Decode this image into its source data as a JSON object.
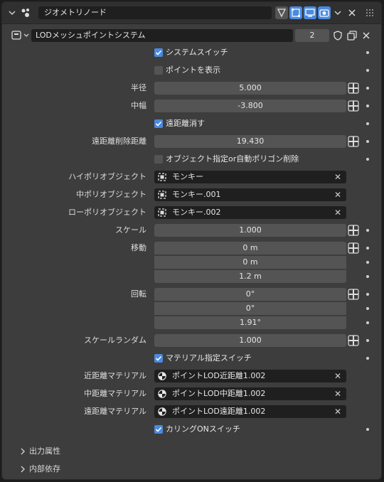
{
  "header": {
    "node_group_name": "ジオメトリノード"
  },
  "modifier": {
    "name": "LODメッシュポイントシステム",
    "user_count": "2"
  },
  "inputs": {
    "system_switch": {
      "label": "システムスイッチ",
      "checked": true
    },
    "show_points": {
      "label": "ポイントを表示",
      "checked": false
    },
    "radius": {
      "label": "半径",
      "value": "5.000"
    },
    "mid_width": {
      "label": "中幅",
      "value": "-3.800"
    },
    "far_delete": {
      "label": "遠距離消す",
      "checked": true
    },
    "far_delete_distance": {
      "label": "遠距離削除距離",
      "value": "19.430"
    },
    "object_or_auto_polygon_delete": {
      "label": "オブジェクト指定or自動ポリゴン削除",
      "checked": false
    },
    "high_poly_object": {
      "label": "ハイポリオブジェクト",
      "value": "モンキー"
    },
    "mid_poly_object": {
      "label": "中ポリオブジェクト",
      "value": "モンキー.001"
    },
    "low_poly_object": {
      "label": "ローポリオブジェクト",
      "value": "モンキー.002"
    },
    "scale": {
      "label": "スケール",
      "value": "1.000"
    },
    "translation": {
      "label": "移動",
      "values": [
        "0 m",
        "0 m",
        "1.2 m"
      ]
    },
    "rotation": {
      "label": "回転",
      "values": [
        "0°",
        "0°",
        "1.91°"
      ]
    },
    "scale_random": {
      "label": "スケールランダム",
      "value": "1.000"
    },
    "material_switch": {
      "label": "マテリアル指定スイッチ",
      "checked": true
    },
    "near_material": {
      "label": "近距離マテリアル",
      "value": "ポイントLOD近距離1.002"
    },
    "mid_material": {
      "label": "中距離マテリアル",
      "value": "ポイントLOD中距離1.002"
    },
    "far_material": {
      "label": "遠距離マテリアル",
      "value": "ポイントLOD遠距離1.002"
    },
    "culling_switch": {
      "label": "カリングONスイッチ",
      "checked": true
    }
  },
  "subpanels": {
    "output_attributes": "出力属性",
    "internal_dependencies": "内部依存"
  },
  "colors": {
    "accent": "#4a8ae0",
    "panel_bg": "#3d3d3d",
    "field_bg": "#545454",
    "object_field_bg": "#1f1f1f"
  }
}
